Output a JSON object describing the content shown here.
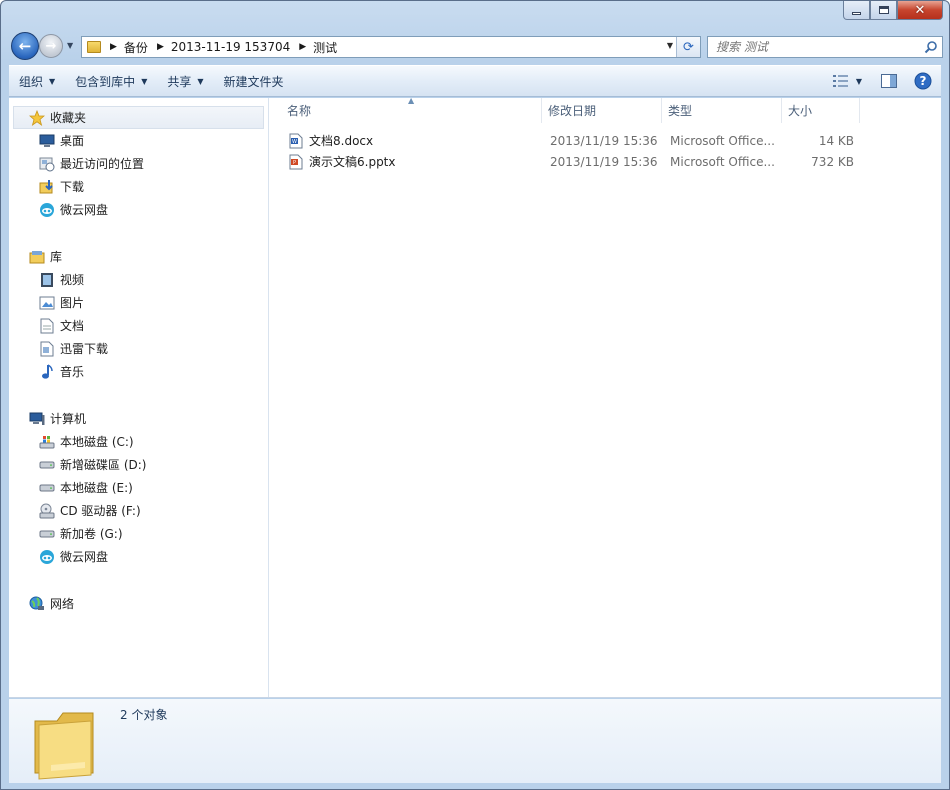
{
  "window": {
    "controls": {
      "minimize": "minimize-icon",
      "maximize": "maximize-icon",
      "close": "close-icon"
    }
  },
  "address_bar": {
    "breadcrumbs": [
      "备份",
      "2013-11-19 153704",
      "测试"
    ]
  },
  "search": {
    "placeholder": "搜索 测试"
  },
  "toolbar": {
    "organize": "组织",
    "include_in_library": "包含到库中",
    "share": "共享",
    "new_folder": "新建文件夹"
  },
  "sidebar": {
    "favorites": {
      "label": "收藏夹",
      "items": [
        {
          "label": "桌面",
          "icon": "desktop-icon"
        },
        {
          "label": "最近访问的位置",
          "icon": "recent-places-icon"
        },
        {
          "label": "下载",
          "icon": "downloads-icon"
        },
        {
          "label": "微云网盘",
          "icon": "weiyun-icon"
        }
      ]
    },
    "libraries": {
      "label": "库",
      "items": [
        {
          "label": "视频",
          "icon": "video-icon"
        },
        {
          "label": "图片",
          "icon": "pictures-icon"
        },
        {
          "label": "文档",
          "icon": "documents-icon"
        },
        {
          "label": "迅雷下载",
          "icon": "thunder-download-icon"
        },
        {
          "label": "音乐",
          "icon": "music-icon"
        }
      ]
    },
    "computer": {
      "label": "计算机",
      "items": [
        {
          "label": "本地磁盘 (C:)",
          "icon": "system-drive-icon"
        },
        {
          "label": "新增磁碟區 (D:)",
          "icon": "drive-icon"
        },
        {
          "label": "本地磁盘 (E:)",
          "icon": "drive-icon"
        },
        {
          "label": "CD 驱动器 (F:)",
          "icon": "cd-drive-icon"
        },
        {
          "label": "新加卷 (G:)",
          "icon": "drive-icon"
        },
        {
          "label": "微云网盘",
          "icon": "weiyun-icon"
        }
      ]
    },
    "network": {
      "label": "网络"
    }
  },
  "columns": {
    "name": "名称",
    "date": "修改日期",
    "type": "类型",
    "size": "大小"
  },
  "files": [
    {
      "name": "文档8.docx",
      "date": "2013/11/19 15:36",
      "type": "Microsoft Office...",
      "size": "14 KB",
      "icon": "word-document-icon"
    },
    {
      "name": "演示文稿6.pptx",
      "date": "2013/11/19 15:36",
      "type": "Microsoft Office...",
      "size": "732 KB",
      "icon": "powerpoint-document-icon"
    }
  ],
  "details": {
    "status": "2 个对象"
  },
  "colors": {
    "accent": "#2a66bd",
    "chrome": "#b9d1ea",
    "folder": "#f2cd5c"
  }
}
